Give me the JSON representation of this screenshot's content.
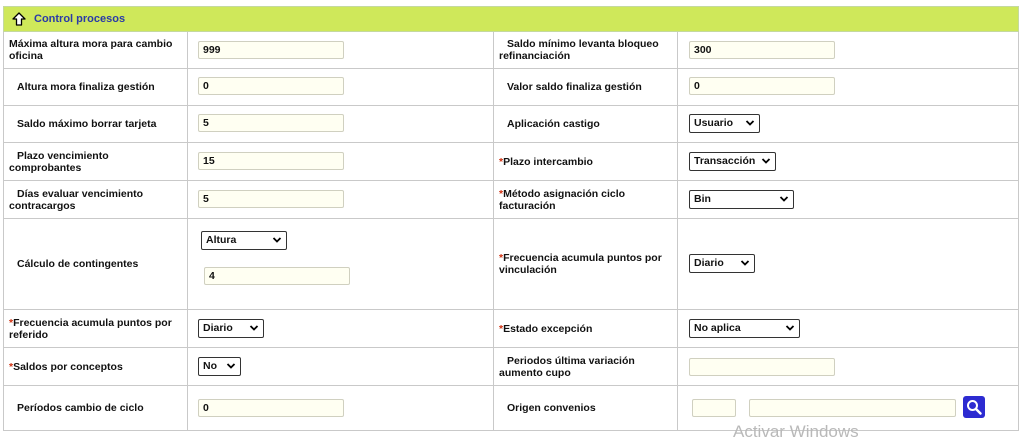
{
  "header": {
    "title": "Control procesos",
    "icon": "arrow-up-icon"
  },
  "rows": [
    {
      "left_label": "Máxima altura mora para cambio oficina",
      "left_value": "999",
      "right_label": "Saldo mínimo levanta bloqueo refinanciación",
      "right_value": "300"
    },
    {
      "left_label": "Altura mora finaliza gestión",
      "left_value": "0",
      "right_label": "Valor saldo finaliza gestión",
      "right_value": "0"
    },
    {
      "left_label": "Saldo máximo borrar tarjeta",
      "left_value": "5",
      "right_label": "Aplicación castigo",
      "right_value": "Usuario"
    },
    {
      "left_label": "Plazo vencimiento comprobantes",
      "left_value": "15",
      "right_label": "Plazo intercambio",
      "right_value": "Transacción"
    },
    {
      "left_label": "Días evaluar vencimiento contracargos",
      "left_value": "5",
      "right_label": "Método asignación ciclo facturación",
      "right_value": "Bin"
    },
    {
      "left_label": "Cálculo de contingentes",
      "left_select": "Altura",
      "left_value": "4",
      "right_label": "Frecuencia acumula puntos por vinculación",
      "right_value": "Diario"
    },
    {
      "left_label": "Frecuencia acumula puntos por referido",
      "left_value": "Diario",
      "right_label": "Estado excepción",
      "right_value": "No aplica"
    },
    {
      "left_label": "Saldos por conceptos",
      "left_value": "No",
      "right_label": "Periodos última variación aumento cupo",
      "right_value": ""
    },
    {
      "left_label": "Períodos cambio de ciclo",
      "left_value": "0",
      "right_label": "Origen convenios",
      "right_value_code": "",
      "right_value_name": ""
    }
  ],
  "required_marker": "*",
  "watermark": "Activar Windows"
}
